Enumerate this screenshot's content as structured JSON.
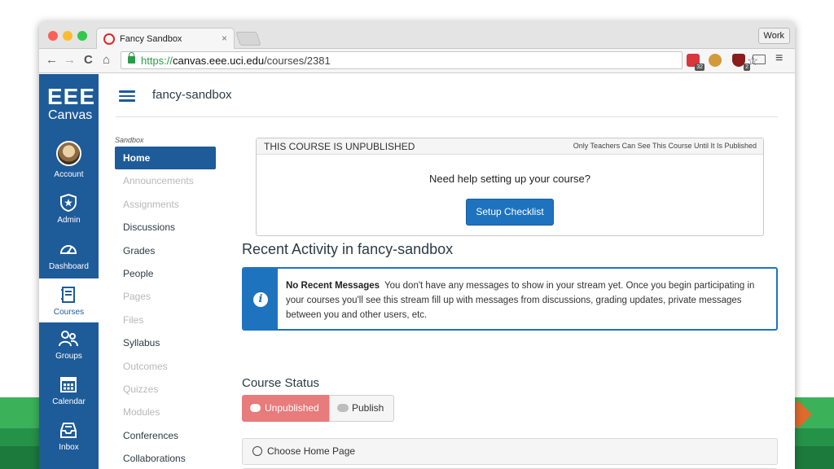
{
  "browser": {
    "tab_title": "Fancy Sandbox",
    "tab_close": "×",
    "profile": "Work",
    "url_scheme": "https://",
    "url_host": "canvas.eee.uci.edu",
    "url_path": "/courses/2381",
    "ext_badge_1": "32",
    "ext_badge_3": "2",
    "back_glyph": "←",
    "forward_glyph": "→",
    "reload_glyph": "C",
    "home_glyph": "⌂",
    "star_glyph": "☆",
    "menu_glyph": "≡"
  },
  "brand": {
    "line1": "EEE",
    "line2": "Canvas"
  },
  "global_nav": [
    {
      "label": "Account",
      "icon": "avatar"
    },
    {
      "label": "Admin",
      "icon": "shield-icon"
    },
    {
      "label": "Dashboard",
      "icon": "dashboard-icon"
    },
    {
      "label": "Courses",
      "icon": "book-icon",
      "active": true
    },
    {
      "label": "Groups",
      "icon": "groups-icon"
    },
    {
      "label": "Calendar",
      "icon": "calendar-icon"
    },
    {
      "label": "Inbox",
      "icon": "inbox-icon"
    }
  ],
  "header": {
    "course": "fancy-sandbox"
  },
  "course_nav": {
    "heading": "Sandbox",
    "items": [
      {
        "label": "Home",
        "state": "active"
      },
      {
        "label": "Announcements",
        "state": "disabled"
      },
      {
        "label": "Assignments",
        "state": "disabled"
      },
      {
        "label": "Discussions",
        "state": "normal"
      },
      {
        "label": "Grades",
        "state": "normal"
      },
      {
        "label": "People",
        "state": "normal"
      },
      {
        "label": "Pages",
        "state": "disabled"
      },
      {
        "label": "Files",
        "state": "disabled"
      },
      {
        "label": "Syllabus",
        "state": "normal"
      },
      {
        "label": "Outcomes",
        "state": "disabled"
      },
      {
        "label": "Quizzes",
        "state": "disabled"
      },
      {
        "label": "Modules",
        "state": "disabled"
      },
      {
        "label": "Conferences",
        "state": "normal"
      },
      {
        "label": "Collaborations",
        "state": "normal"
      }
    ]
  },
  "unpublished": {
    "title": "THIS COURSE IS UNPUBLISHED",
    "note": "Only Teachers Can See This Course Until It Is Published",
    "help": "Need help setting up your course?",
    "button": "Setup Checklist"
  },
  "recent": {
    "title": "Recent Activity in fancy-sandbox",
    "bold": "No Recent Messages",
    "message": "You don't have any messages to show in your stream yet. Once you begin participating in your courses you'll see this stream fill up with messages from discussions, grading updates, private messages between you and other users, etc."
  },
  "status": {
    "title": "Course Status",
    "unpublished": "Unpublished",
    "publish": "Publish",
    "home_page": "Choose Home Page"
  },
  "colors": {
    "brand_blue": "#1e5b99",
    "button_blue": "#1e73be",
    "unpublished_red": "#e87b7b",
    "background_green": "#3bb25a"
  }
}
